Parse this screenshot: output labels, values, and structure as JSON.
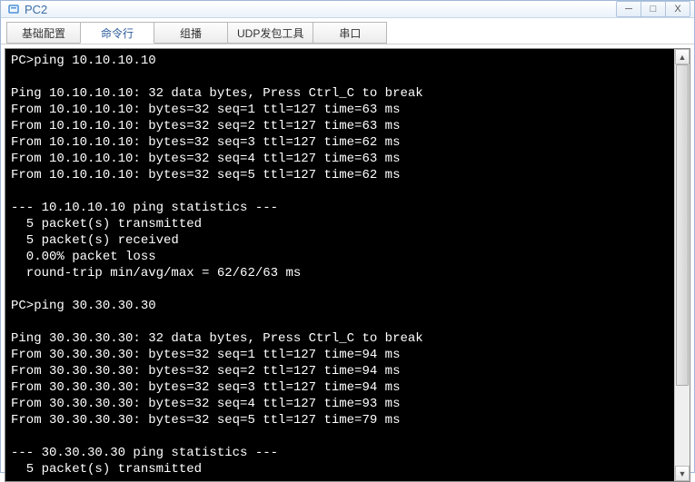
{
  "window": {
    "title": "PC2",
    "controls": {
      "minimize": "─",
      "maximize": "□",
      "close": "X"
    }
  },
  "tabs": [
    {
      "label": "基础配置",
      "active": false
    },
    {
      "label": "命令行",
      "active": true
    },
    {
      "label": "组播",
      "active": false
    },
    {
      "label": "UDP发包工具",
      "active": false
    },
    {
      "label": "串口",
      "active": false
    }
  ],
  "terminal": {
    "lines": [
      "PC>ping 10.10.10.10",
      "",
      "Ping 10.10.10.10: 32 data bytes, Press Ctrl_C to break",
      "From 10.10.10.10: bytes=32 seq=1 ttl=127 time=63 ms",
      "From 10.10.10.10: bytes=32 seq=2 ttl=127 time=63 ms",
      "From 10.10.10.10: bytes=32 seq=3 ttl=127 time=62 ms",
      "From 10.10.10.10: bytes=32 seq=4 ttl=127 time=63 ms",
      "From 10.10.10.10: bytes=32 seq=5 ttl=127 time=62 ms",
      "",
      "--- 10.10.10.10 ping statistics ---",
      "  5 packet(s) transmitted",
      "  5 packet(s) received",
      "  0.00% packet loss",
      "  round-trip min/avg/max = 62/62/63 ms",
      "",
      "PC>ping 30.30.30.30",
      "",
      "Ping 30.30.30.30: 32 data bytes, Press Ctrl_C to break",
      "From 30.30.30.30: bytes=32 seq=1 ttl=127 time=94 ms",
      "From 30.30.30.30: bytes=32 seq=2 ttl=127 time=94 ms",
      "From 30.30.30.30: bytes=32 seq=3 ttl=127 time=94 ms",
      "From 30.30.30.30: bytes=32 seq=4 ttl=127 time=93 ms",
      "From 30.30.30.30: bytes=32 seq=5 ttl=127 time=79 ms",
      "",
      "--- 30.30.30.30 ping statistics ---",
      "  5 packet(s) transmitted"
    ]
  },
  "scrollbar": {
    "up": "▲",
    "down": "▼"
  }
}
